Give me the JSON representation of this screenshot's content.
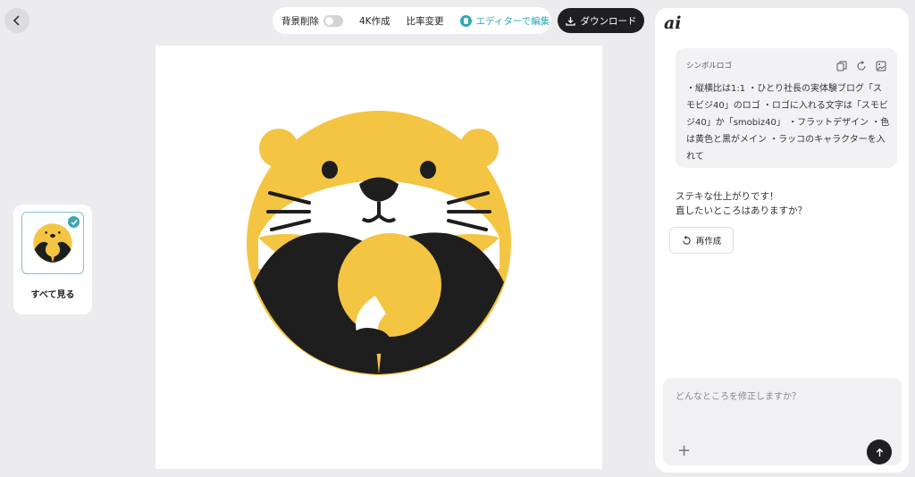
{
  "toolbar": {
    "remove_bg_label": "背景削除",
    "upscale_label": "4K作成",
    "ratio_label": "比率変更",
    "editor_label": "エディターで編集"
  },
  "download_label": "ダウンロード",
  "thumbnails": {
    "see_all_label": "すべて見る"
  },
  "chat": {
    "logo": "ai",
    "prompt_title": "シンボルロゴ",
    "prompt_text": "・縦横比は1:1 ・ひとり社長の実体験ブログ「スモビジ40」のロゴ ・ロゴに入れる文字は「スモビジ40」か「smobiz40」 ・フラットデザイン ・色は黄色と黒がメイン ・ラッコのキャラクターを入れて",
    "reply_line1": "ステキな仕上がりです！",
    "reply_line2": "直したいところはありますか？",
    "redo_label": "再作成",
    "input_placeholder": "どんなところを修正しますか？"
  },
  "colors": {
    "yellow": "#f4c542",
    "black": "#1e1e1e",
    "accent": "#2ba7b7"
  },
  "icons": [
    "back-arrow-icon",
    "download-icon",
    "copy-icon",
    "refresh-icon",
    "image-icon",
    "redo-icon",
    "plus-icon",
    "send-arrow-icon",
    "check-icon"
  ]
}
